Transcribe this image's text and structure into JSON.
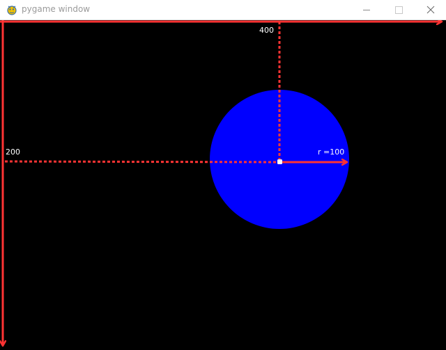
{
  "window": {
    "title": "pygame window",
    "app_icon": "pygame-snake-icon",
    "controls": {
      "minimize": "minimize-icon",
      "maximize": "maximize-icon",
      "close": "close-icon"
    }
  },
  "scene": {
    "background_color": "#000000",
    "axis_color": "#ff3333",
    "circle_color": "#0000ff",
    "center_dot_color": "#ffffff",
    "x_label": "400",
    "y_label": "200",
    "radius_label": "r =100"
  }
}
